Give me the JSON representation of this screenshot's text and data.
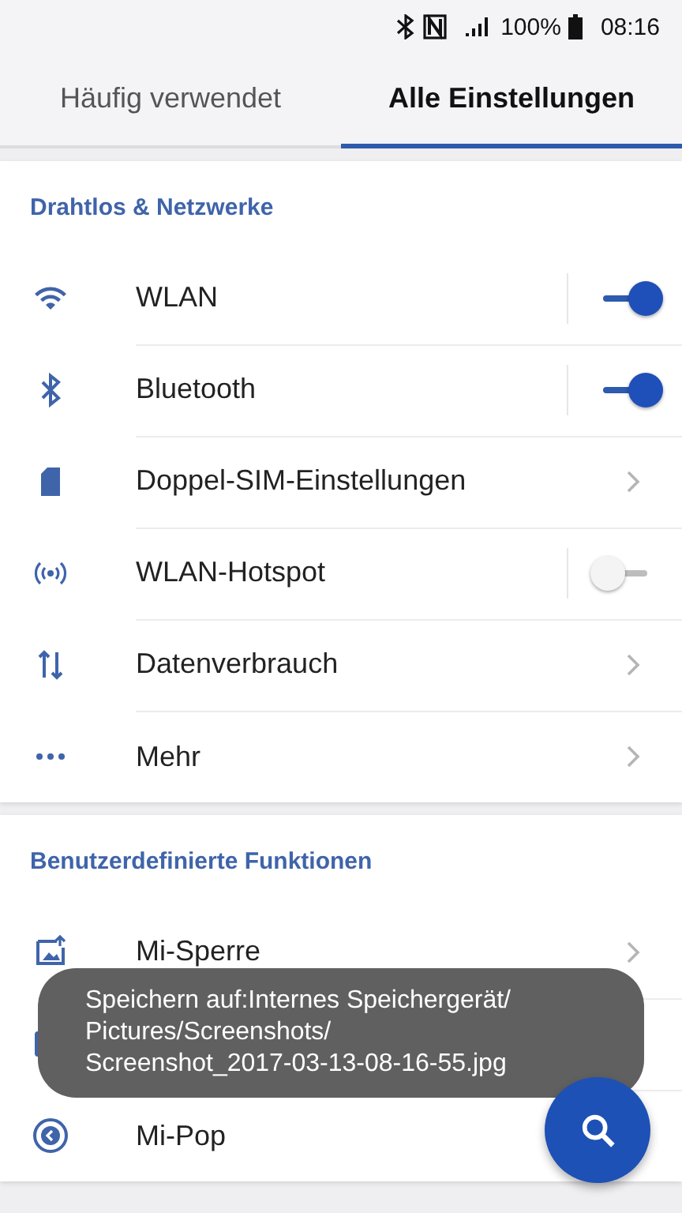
{
  "status_bar": {
    "battery": "100%",
    "time": "08:16"
  },
  "tabs": [
    {
      "label": "Häufig verwendet",
      "selected": false
    },
    {
      "label": "Alle Einstellungen",
      "selected": true
    }
  ],
  "sections": [
    {
      "title": "Drahtlos & Netzwerke",
      "items": [
        {
          "label": "WLAN",
          "kind": "toggle",
          "on": true
        },
        {
          "label": "Bluetooth",
          "kind": "toggle",
          "on": true
        },
        {
          "label": "Doppel-SIM-Einstellungen",
          "kind": "link"
        },
        {
          "label": "WLAN-Hotspot",
          "kind": "toggle",
          "on": false
        },
        {
          "label": "Datenverbrauch",
          "kind": "link"
        },
        {
          "label": "Mehr",
          "kind": "link"
        }
      ]
    },
    {
      "title": "Benutzerdefinierte Funktionen",
      "items": [
        {
          "label": "Mi-Sperre",
          "kind": "link"
        },
        {
          "kind": "plain"
        },
        {
          "label": "Mi-Pop",
          "kind": "plain"
        }
      ]
    }
  ],
  "toast": {
    "lines": [
      "Speichern auf:Internes Speichergerät/",
      "Pictures/Screenshots/",
      "Screenshot_2017-03-13-08-16-55.jpg"
    ]
  }
}
